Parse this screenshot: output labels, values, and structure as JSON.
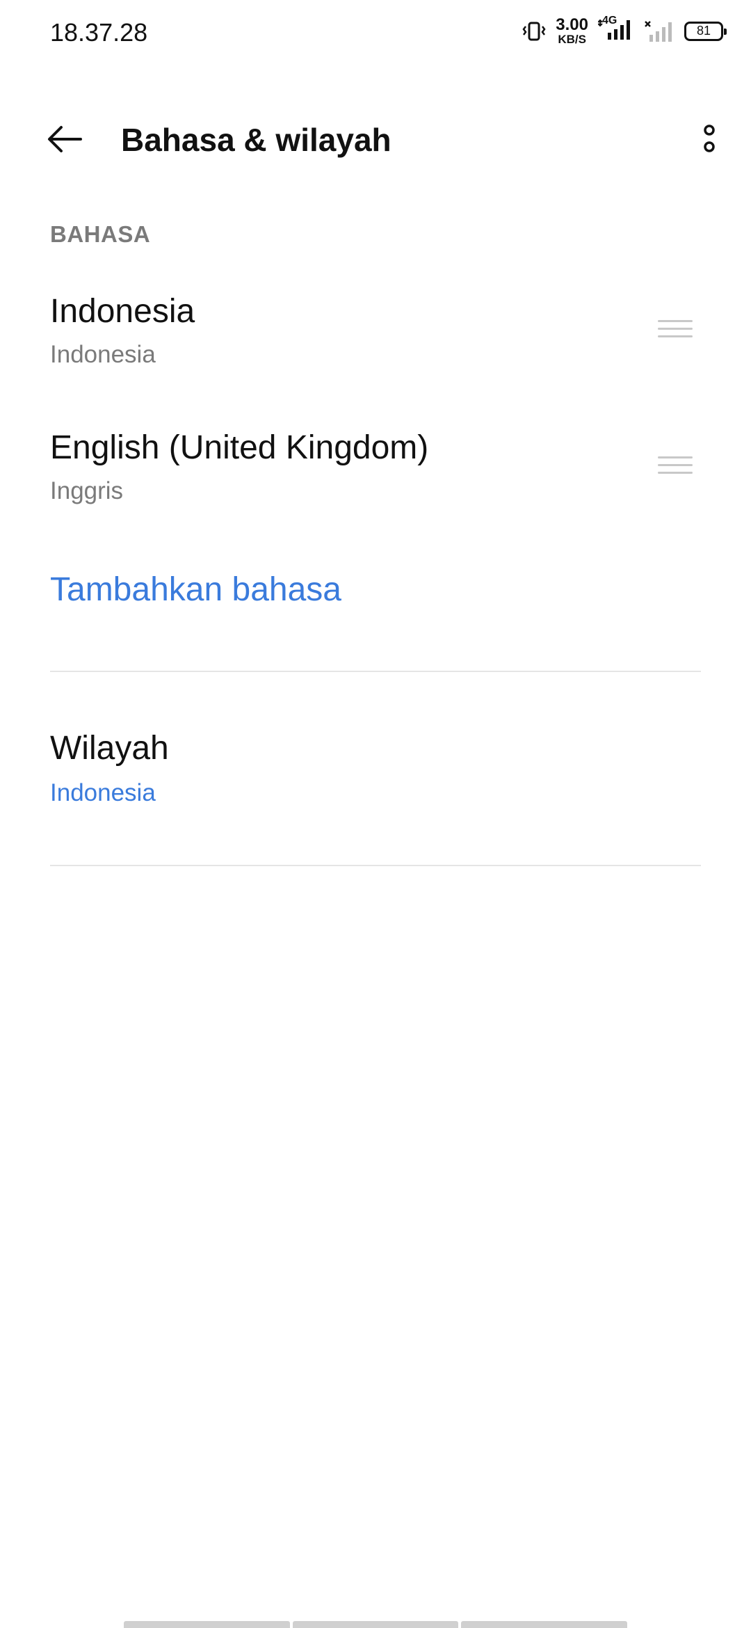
{
  "status_bar": {
    "time": "18.37.28",
    "speed_value": "3.00",
    "speed_unit": "KB/S",
    "network": "4G",
    "battery": "81"
  },
  "app_bar": {
    "title": "Bahasa & wilayah",
    "back_icon": "arrow-left-icon",
    "more_icon": "more-vertical-icon"
  },
  "language_section": {
    "header": "BAHASA",
    "languages": [
      {
        "name": "Indonesia",
        "native": "Indonesia"
      },
      {
        "name": "English (United Kingdom)",
        "native": "Inggris"
      }
    ],
    "add_label": "Tambahkan bahasa"
  },
  "region": {
    "label": "Wilayah",
    "value": "Indonesia"
  },
  "colors": {
    "accent": "#3a7bdc",
    "secondary_text": "#7a7a7a",
    "divider": "#e5e5e5"
  }
}
